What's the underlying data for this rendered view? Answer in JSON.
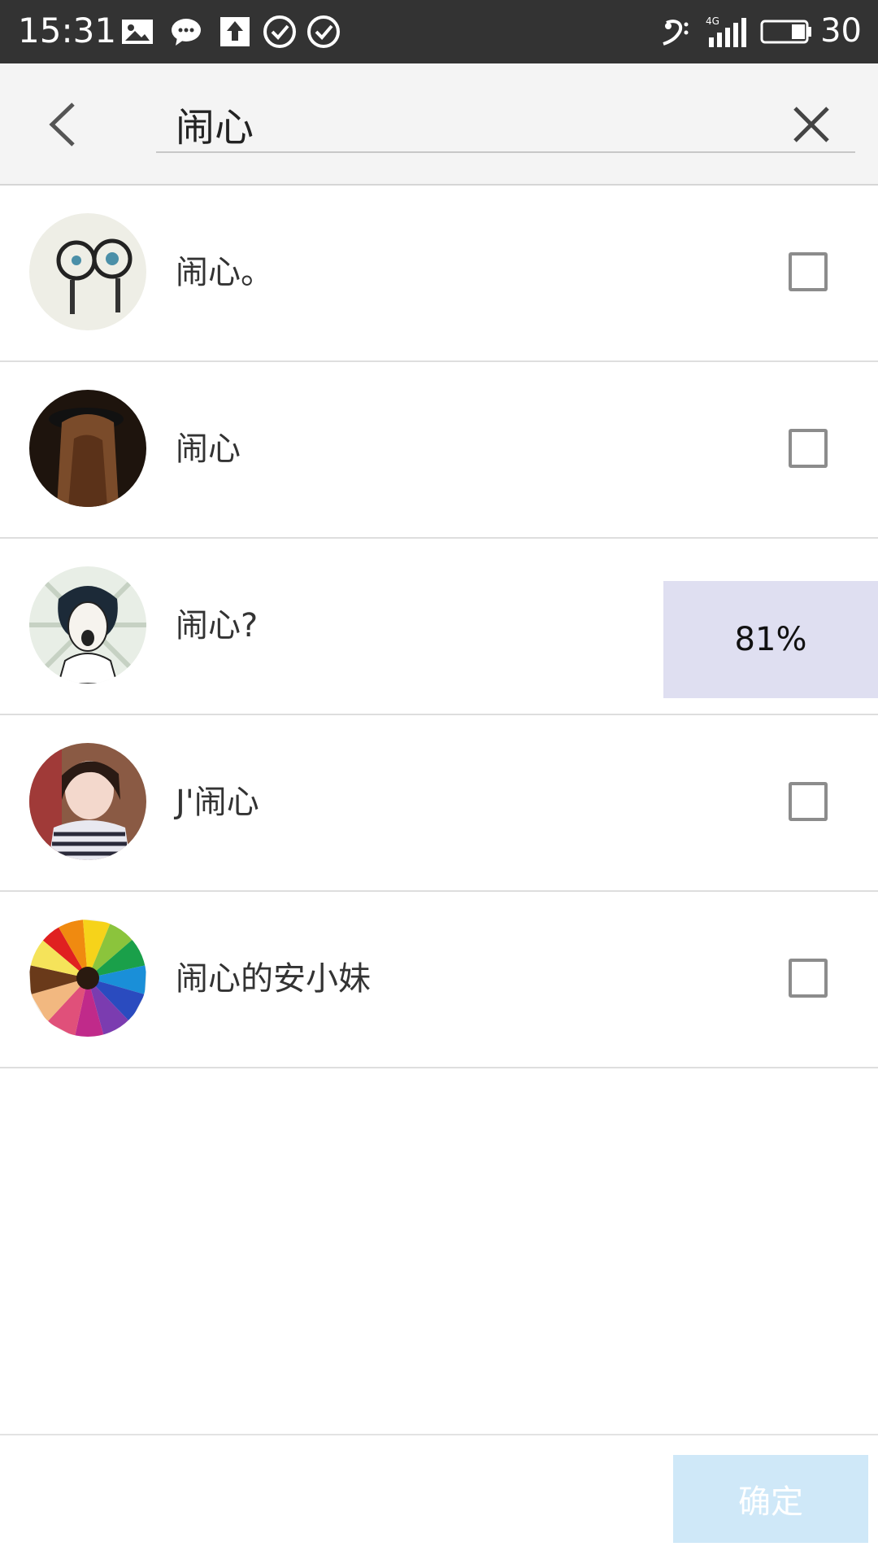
{
  "status_bar": {
    "time": "15:31",
    "network": "4G",
    "battery": "30"
  },
  "search": {
    "value": "闹心"
  },
  "results": [
    {
      "name": "闹心。"
    },
    {
      "name": "闹心"
    },
    {
      "name": "闹心?"
    },
    {
      "name": "J'闹心"
    },
    {
      "name": "闹心的安小妹"
    }
  ],
  "progress": {
    "value": 81,
    "label": "81%"
  },
  "footer": {
    "confirm_label": "确定"
  },
  "colors": {
    "status_bar_bg": "#333333",
    "header_bg": "#f4f4f4",
    "confirm_disabled_bg": "#cfe8f8",
    "progress_bg": "#dfdff1"
  }
}
